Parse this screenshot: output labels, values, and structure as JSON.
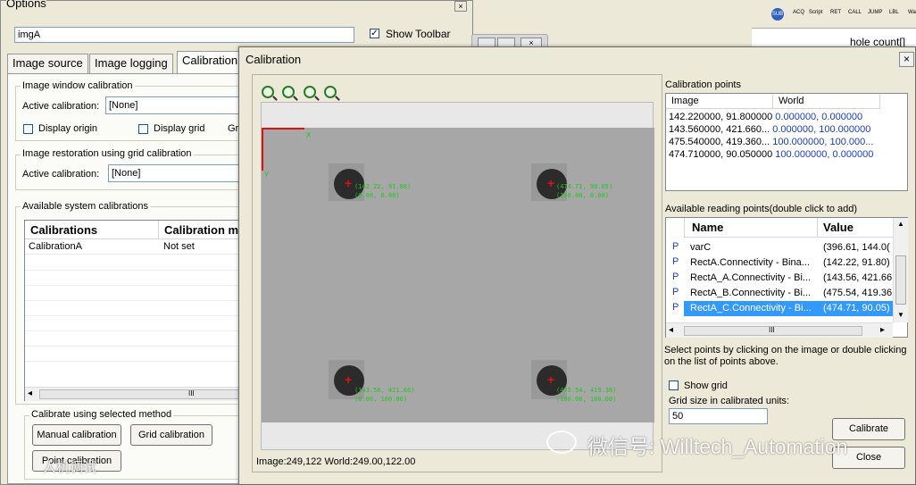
{
  "options": {
    "title": "Options",
    "image_name": "imgA",
    "show_toolbar": "Show Toolbar",
    "tabs": [
      "Image source",
      "Image logging",
      "Calibration"
    ],
    "iwc_title": "Image window calibration",
    "active_calibration_label": "Active calibration:",
    "active_calibration_value": "[None]",
    "display_origin": "Display origin",
    "display_grid": "Display grid",
    "grid_cut": "Gri",
    "irg_title": "Image restoration using grid calibration",
    "active_calibration_label2": "Active calibration:",
    "active_calibration_value2": "[None]",
    "asc_title": "Available system calibrations",
    "col_calibrations": "Calibrations",
    "col_method": "Calibration m",
    "row_name": "CalibrationA",
    "row_status": "Not set",
    "scroll_mark": "III",
    "method_title": "Calibrate using selected method",
    "manual_btn": "Manual calibration",
    "grid_btn": "Grid calibration",
    "point_btn": "Point calibration"
  },
  "calibration": {
    "title": "Calibration",
    "close_x": "×",
    "status": "Image:249,122 World:249.00,122.00",
    "axis_x": "X",
    "axis_y": "Y",
    "points_label": "Calibration points",
    "points_cols": [
      "Image",
      "World"
    ],
    "points": [
      {
        "image": "142.220000, 91.800000",
        "world": "0.000000, 0.000000"
      },
      {
        "image": "143.560000, 421.660...",
        "world": "0.000000, 100.000000"
      },
      {
        "image": "475.540000, 419.360...",
        "world": "100.000000, 100.000..."
      },
      {
        "image": "474.710000, 90.050000",
        "world": "100.000000, 0.000000"
      }
    ],
    "reading_label": "Available reading points(double click to add)",
    "reading_cols": [
      "Name",
      "Value"
    ],
    "reading": [
      {
        "p": "P",
        "name": "varC",
        "value": "(396.61, 144.0("
      },
      {
        "p": "P",
        "name": "RectA.Connectivity - Bina...",
        "value": "(142.22, 91.80)"
      },
      {
        "p": "P",
        "name": "RectA_A.Connectivity - Bi...",
        "value": "(143.56, 421.66"
      },
      {
        "p": "P",
        "name": "RectA_B.Connectivity - Bi...",
        "value": "(475.54, 419.36"
      },
      {
        "p": "P",
        "name": "RectA_C.Connectivity - Bi...",
        "value": "(474.71, 90.05)"
      }
    ],
    "scroll_mark": "III",
    "help_text": "Select points by clicking on the image or double clicking on the list of points above.",
    "show_grid": "Show grid",
    "grid_size_label": "Grid size in calibrated units:",
    "grid_size_value": "50",
    "calibrate_btn": "Calibrate",
    "close_btn": "Close",
    "labels": [
      {
        "l1": "(142.22, 91.80)",
        "l2": "(0.00, 0.00)"
      },
      {
        "l1": "(474.71, 90.05)",
        "l2": "(100.00, 0.00)"
      },
      {
        "l1": "(143.56, 421.66)",
        "l2": "(0.00, 100.00)"
      },
      {
        "l1": "(475.54, 419.36)",
        "l2": "(100.00, 100.00)"
      }
    ]
  },
  "bg_app": {
    "toolbar_labels": [
      "SUB",
      "ACQ",
      "Script",
      "RET",
      "CALL",
      "JUMP",
      "LBL",
      "Wa"
    ],
    "tree_text": "hole count[]"
  },
  "watermark": {
    "wechat": "微信号: Willtech_Automation",
    "bottom_left": "人机调试"
  }
}
